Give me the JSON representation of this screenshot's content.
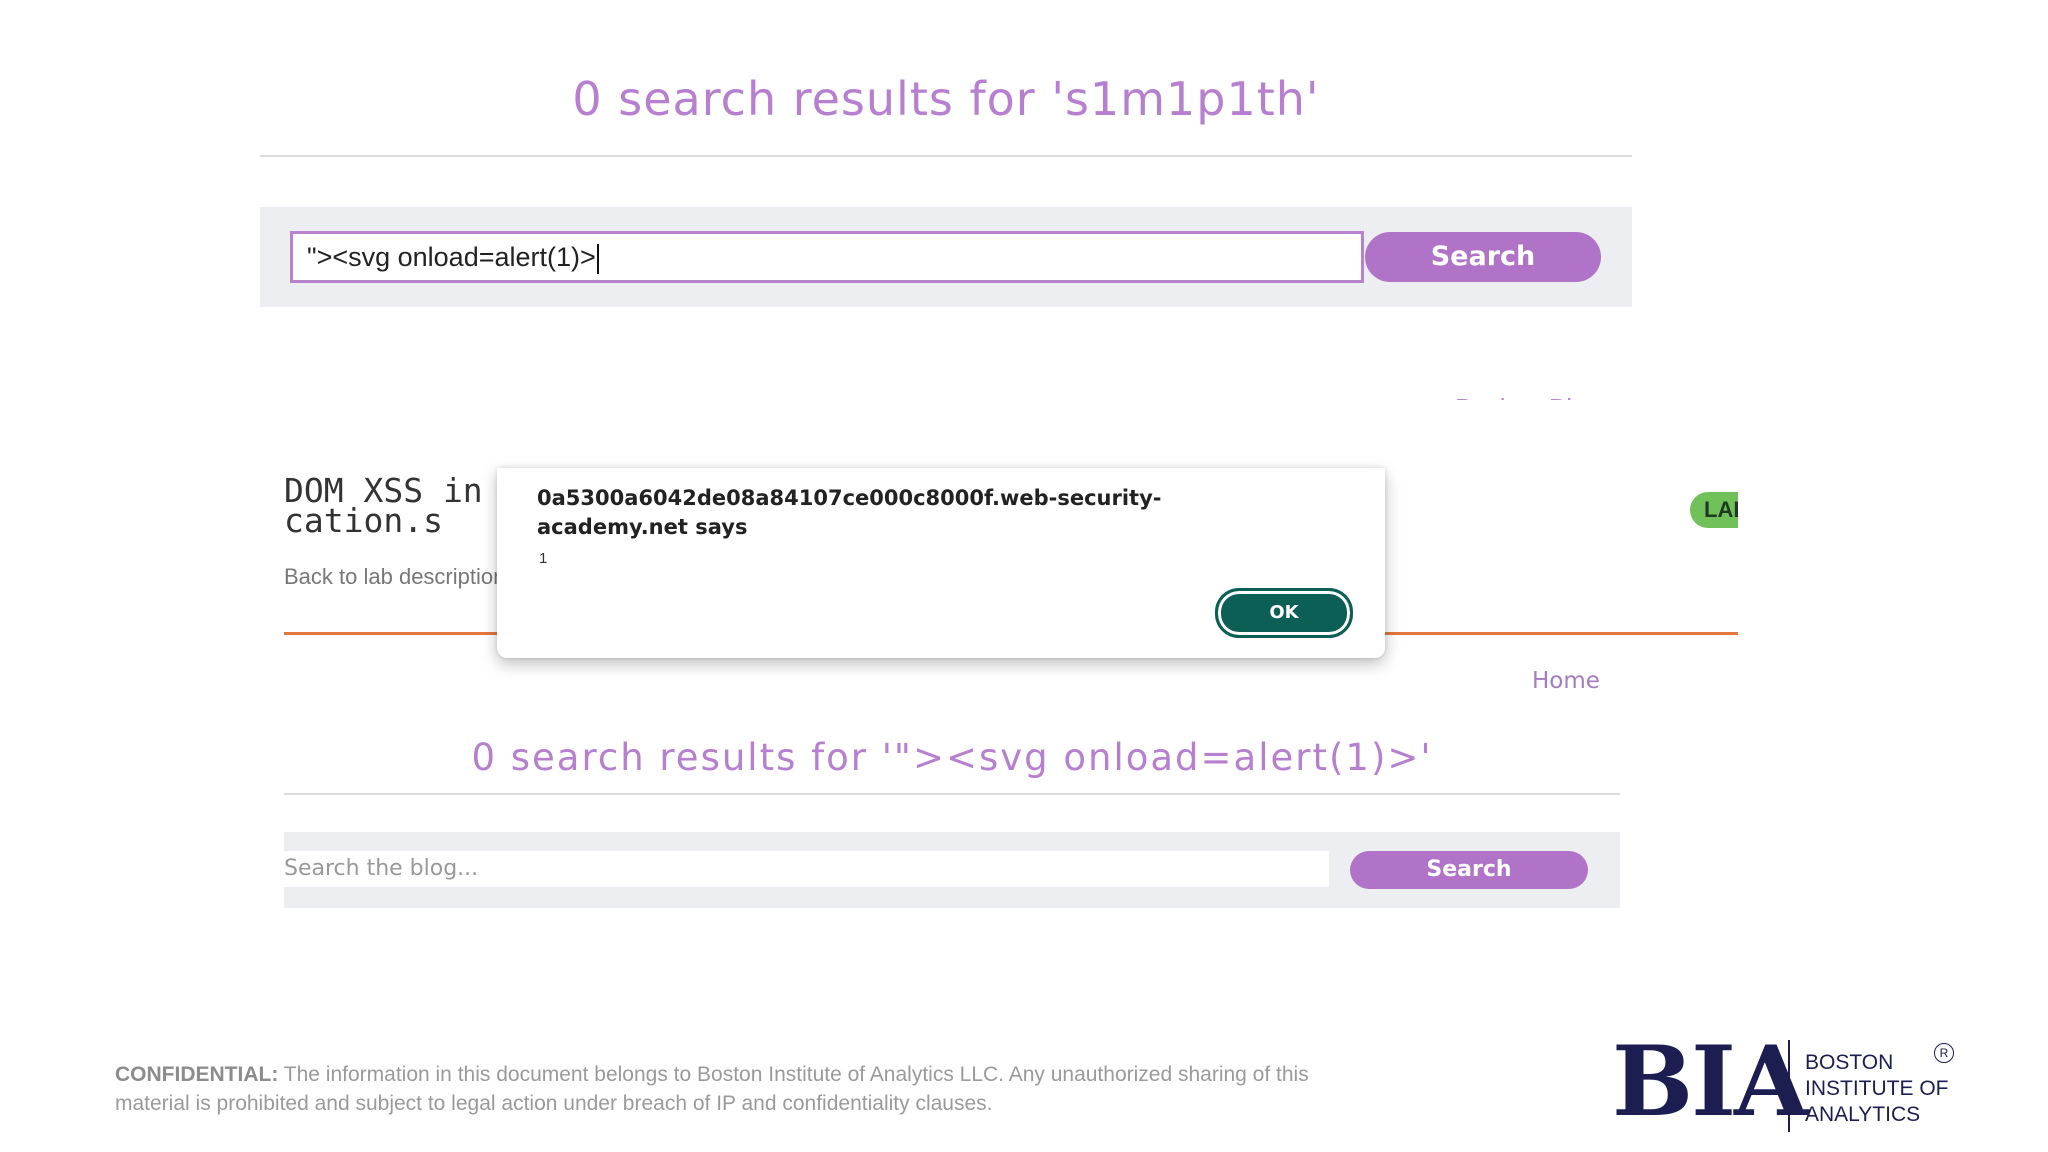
{
  "top": {
    "title": "0 search results for 's1m1p1th'",
    "search_value": "\"><svg onload=alert(1)>",
    "search_button": "Search",
    "cut_link": "Back to Blog"
  },
  "lab": {
    "title_line1": "DOM XSS in",
    "title_line2": "cation.s",
    "back_link": "Back to lab description",
    "badge": "LAB"
  },
  "dialog": {
    "title_line1": "0a5300a6042de08a84107ce000c8000f.web-security-",
    "title_line2": "academy.net says",
    "message": "1",
    "ok_label": "OK"
  },
  "bottom": {
    "home_link": "Home",
    "title": "0 search results for '\"><svg onload=alert(1)>'",
    "search_placeholder": "Search the blog...",
    "search_button": "Search"
  },
  "footer": {
    "confidential_label": "CONFIDENTIAL:",
    "confidential_text_line1": " The information in this document belongs to Boston Institute of Analytics LLC. Any unauthorized sharing of this",
    "confidential_text_line2": "material is prohibited and subject to legal action under breach of IP and confidentiality clauses.",
    "logo_abbr": "BIA",
    "logo_line1": "BOSTON",
    "logo_line2": "INSTITUTE OF",
    "logo_line3": "ANALYTICS",
    "logo_reg": "R"
  },
  "colors": {
    "accent_purple": "#b173c7",
    "ok_green": "#0b5f55",
    "lab_rule_orange": "#e3773e",
    "brand_navy": "#1c1e52"
  }
}
